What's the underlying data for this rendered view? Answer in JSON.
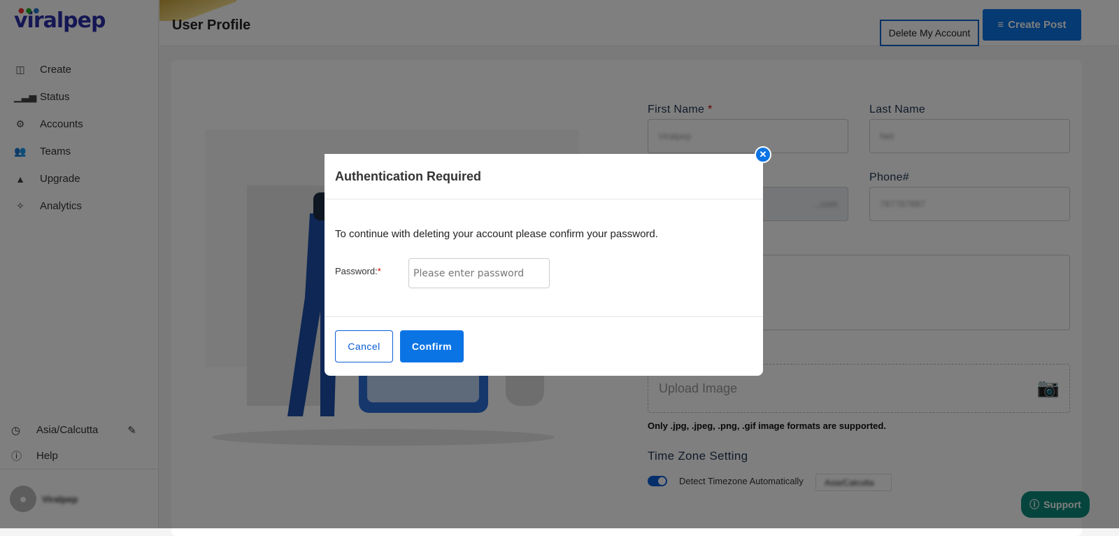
{
  "brand": {
    "logo": "viralpep"
  },
  "sidebar": {
    "items": [
      {
        "label": "Create",
        "icon": "layout-icon"
      },
      {
        "label": "Status",
        "icon": "bar-chart-icon"
      },
      {
        "label": "Accounts",
        "icon": "user-gear-icon"
      },
      {
        "label": "Teams",
        "icon": "users-icon"
      },
      {
        "label": "Upgrade",
        "icon": "rocket-icon"
      },
      {
        "label": "Analytics",
        "icon": "sparkle-chart-icon"
      }
    ],
    "timezone": "Asia/Calcutta",
    "help": "Help",
    "user": "Viralpep"
  },
  "header": {
    "title": "User Profile",
    "delete_label": "Delete My Account",
    "create_label": "Create Post"
  },
  "form": {
    "first_name_label": "First Name",
    "first_name": "Viralpep",
    "last_name_label": "Last Name",
    "last_name": "Net",
    "email": "...com",
    "phone_label": "Phone#",
    "phone": "787787887",
    "upload_placeholder": "Upload Image",
    "formats_note": "Only .jpg, .jpeg, .png, .gif image formats are supported.",
    "tz_heading": "Time Zone Setting",
    "tz_toggle_label": "Detect Timezone Automatically",
    "tz_auto": true,
    "tz_value": "Asia/Calcutta"
  },
  "support": "Support",
  "modal": {
    "title": "Authentication Required",
    "message": "To continue with deleting your account please confirm your password.",
    "password_label": "Password:",
    "password_placeholder": "Please enter password",
    "cancel": "Cancel",
    "confirm": "Confirm"
  },
  "colors": {
    "primary": "#0b74e5",
    "support": "#0c8a7a"
  }
}
